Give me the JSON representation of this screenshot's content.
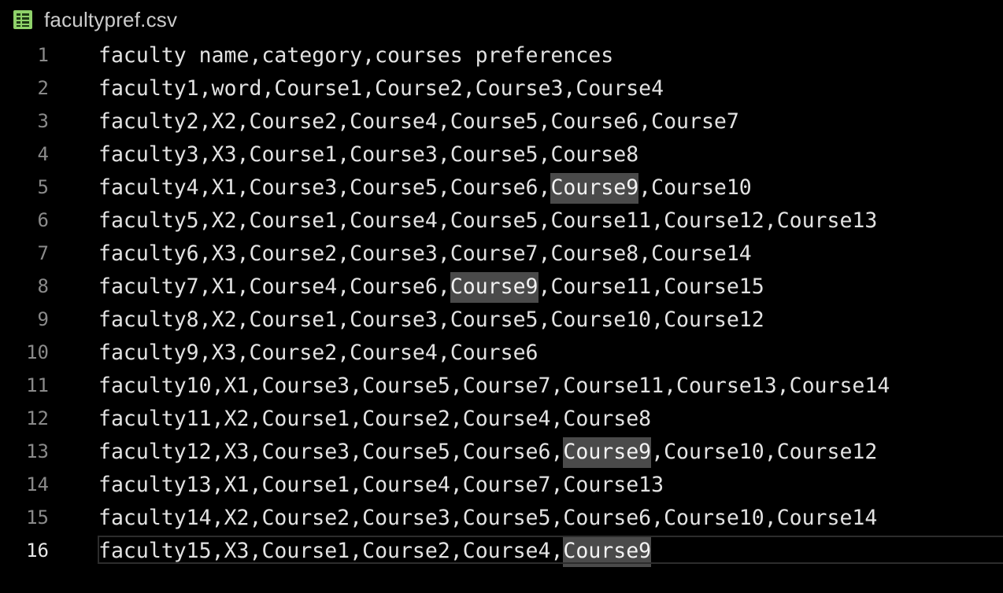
{
  "file": {
    "name": "facultypref.csv",
    "icon": "spreadsheet-icon",
    "icon_color": "#8fd26a"
  },
  "current_line": 16,
  "highlight_term": "Course9",
  "lines": [
    {
      "number": "1",
      "text": "faculty name,category,courses preferences"
    },
    {
      "number": "2",
      "text": "faculty1,word,Course1,Course2,Course3,Course4"
    },
    {
      "number": "3",
      "text": "faculty2,X2,Course2,Course4,Course5,Course6,Course7"
    },
    {
      "number": "4",
      "text": "faculty3,X3,Course1,Course3,Course5,Course8"
    },
    {
      "number": "5",
      "text": "faculty4,X1,Course3,Course5,Course6,Course9,Course10"
    },
    {
      "number": "6",
      "text": "faculty5,X2,Course1,Course4,Course5,Course11,Course12,Course13"
    },
    {
      "number": "7",
      "text": "faculty6,X3,Course2,Course3,Course7,Course8,Course14"
    },
    {
      "number": "8",
      "text": "faculty7,X1,Course4,Course6,Course9,Course11,Course15"
    },
    {
      "number": "9",
      "text": "faculty8,X2,Course1,Course3,Course5,Course10,Course12"
    },
    {
      "number": "10",
      "text": "faculty9,X3,Course2,Course4,Course6"
    },
    {
      "number": "11",
      "text": "faculty10,X1,Course3,Course5,Course7,Course11,Course13,Course14"
    },
    {
      "number": "12",
      "text": "faculty11,X2,Course1,Course2,Course4,Course8"
    },
    {
      "number": "13",
      "text": "faculty12,X3,Course3,Course5,Course6,Course9,Course10,Course12"
    },
    {
      "number": "14",
      "text": "faculty13,X1,Course1,Course4,Course7,Course13"
    },
    {
      "number": "15",
      "text": "faculty14,X2,Course2,Course3,Course5,Course6,Course10,Course14"
    },
    {
      "number": "16",
      "text": "faculty15,X3,Course1,Course2,Course4,Course9"
    }
  ]
}
